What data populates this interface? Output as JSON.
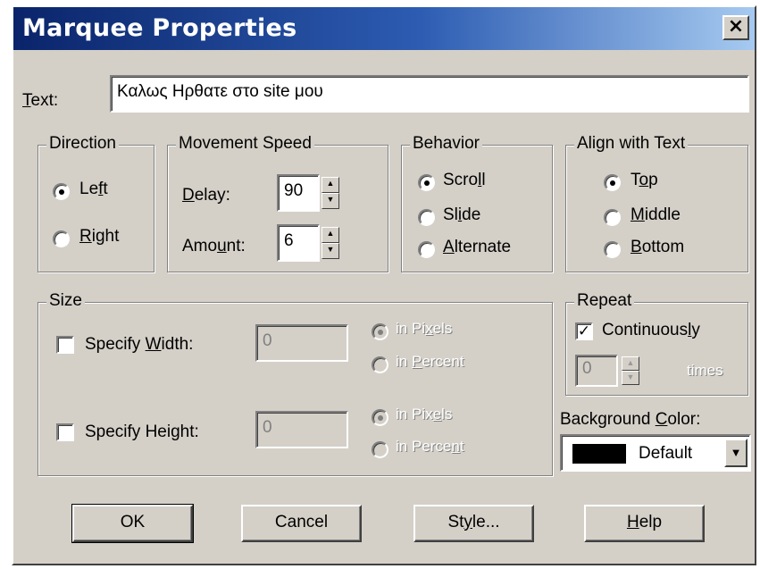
{
  "dialog": {
    "title": "Marquee Properties",
    "close_glyph": "×"
  },
  "text_field": {
    "label_pre": "",
    "label_ul": "T",
    "label_post": "ext:",
    "value": "Καλως Ηρθατε στο site μου"
  },
  "direction": {
    "title": "Direction",
    "left": {
      "pre": "Le",
      "ul": "f",
      "post": "t",
      "selected": true
    },
    "right": {
      "pre": "",
      "ul": "R",
      "post": "ight",
      "selected": false
    }
  },
  "movement": {
    "title": "Movement Speed",
    "delay": {
      "pre": "",
      "ul": "D",
      "post": "elay:",
      "value": "90"
    },
    "amount": {
      "pre": "Amo",
      "ul": "u",
      "post": "nt:",
      "value": "6"
    }
  },
  "behavior": {
    "title": "Behavior",
    "scroll": {
      "pre": "Scro",
      "ul": "l",
      "post": "l",
      "selected": true
    },
    "slide": {
      "pre": "Sl",
      "ul": "i",
      "post": "de",
      "selected": false
    },
    "alternate": {
      "pre": "",
      "ul": "A",
      "post": "lternate",
      "selected": false
    }
  },
  "align": {
    "title": "Align with Text",
    "top": {
      "pre": "T",
      "ul": "o",
      "post": "p",
      "selected": true
    },
    "middle": {
      "pre": "",
      "ul": "M",
      "post": "iddle",
      "selected": false
    },
    "bottom": {
      "pre": "",
      "ul": "B",
      "post": "ottom",
      "selected": false
    }
  },
  "size": {
    "title": "Size",
    "width": {
      "pre": "Specify ",
      "ul": "W",
      "post": "idth:",
      "checked": false,
      "value": "0",
      "pixels": {
        "pre": "in Pi",
        "ul": "x",
        "post": "els"
      },
      "percent": {
        "pre": "in ",
        "ul": "P",
        "post": "ercent"
      }
    },
    "height": {
      "pre": "Specify Height:",
      "checked": false,
      "value": "0",
      "pixels": {
        "pre": "in Pix",
        "ul": "e",
        "post": "ls"
      },
      "percent": {
        "pre": "in Perce",
        "ul": "n",
        "post": "t"
      }
    }
  },
  "repeat": {
    "title": "Repeat",
    "continuously": {
      "pre": "Continuous",
      "ul": "l",
      "post": "y",
      "checked": true
    },
    "value": "0",
    "times": "times"
  },
  "background": {
    "pre": "Background ",
    "ul": "C",
    "post": "olor:",
    "value": "Default",
    "swatch_color": "#000000"
  },
  "buttons": {
    "ok": "OK",
    "cancel": "Cancel",
    "style": {
      "pre": "St",
      "ul": "y",
      "post": "le..."
    },
    "help": {
      "pre": "",
      "ul": "H",
      "post": "elp"
    }
  }
}
